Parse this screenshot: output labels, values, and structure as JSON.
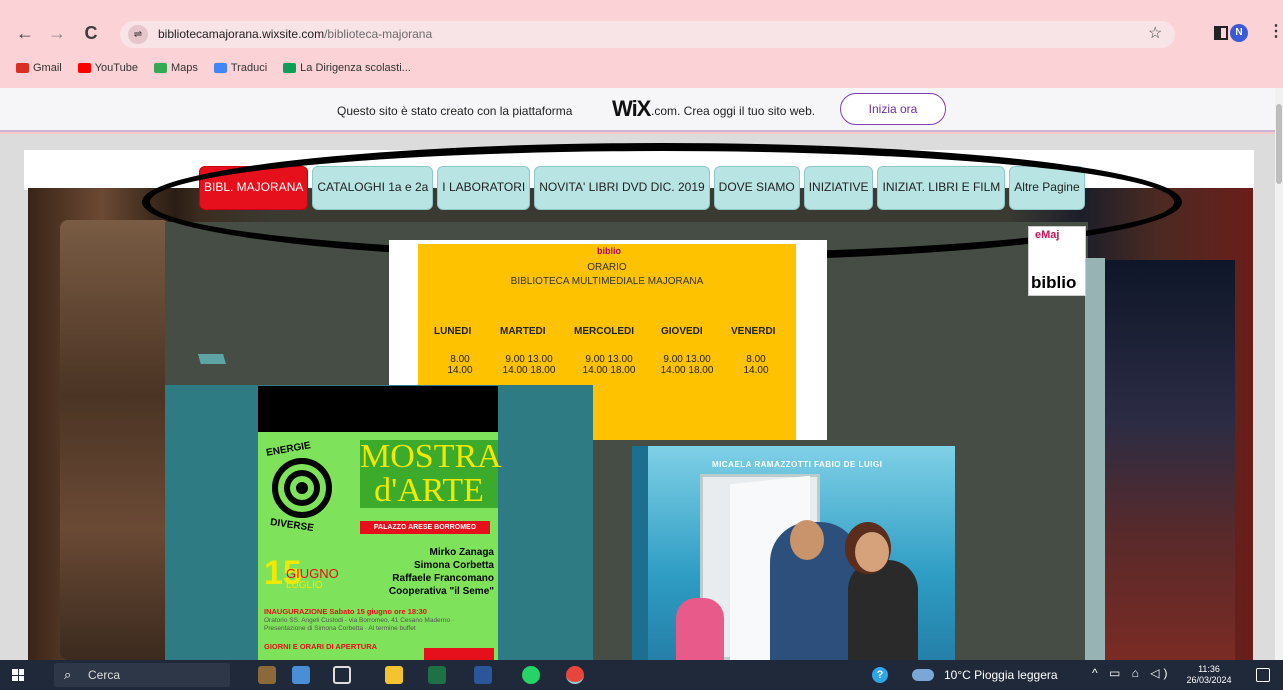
{
  "browser": {
    "nav": {
      "back": "←",
      "forward": "→",
      "reload": "C"
    },
    "url_host": "bibliotecamajorana.wixsite.com",
    "url_path": "/biblioteca-majorana",
    "star": "☆",
    "profile_initial": "N",
    "menu": "⋮"
  },
  "bookmarks": [
    {
      "label": "Gmail",
      "color": "#d93025"
    },
    {
      "label": "YouTube",
      "color": "#ff0000"
    },
    {
      "label": "Maps",
      "color": "#34a853"
    },
    {
      "label": "Traduci",
      "color": "#4285f4"
    },
    {
      "label": "La Dirigenza scolasti...",
      "color": "#0f9d58"
    }
  ],
  "wix_banner": {
    "text": "Questo sito è stato creato con la piattaforma",
    "logo": "WiX",
    "suffix": ".com. Crea oggi il tuo sito web.",
    "button": "Inizia ora"
  },
  "site_menu": [
    {
      "label": "BIBL. MAJORANA",
      "active": true
    },
    {
      "label": "CATALOGHI 1a e 2a",
      "active": false
    },
    {
      "label": "I LABORATORI",
      "active": false
    },
    {
      "label": "NOVITA' LIBRI DVD DIC. 2019",
      "active": false
    },
    {
      "label": "DOVE SIAMO",
      "active": false
    },
    {
      "label": "INIZIATIVE",
      "active": false
    },
    {
      "label": "INIZIAT. LIBRI E FILM",
      "active": false
    },
    {
      "label": "Altre Pagine",
      "active": false
    }
  ],
  "biblio_logo": {
    "top": "eMaj",
    "word": "biblio"
  },
  "orario": {
    "logo": "biblio",
    "title": "ORARIO",
    "subtitle": "BIBLIOTECA MULTIMEDIALE MAJORANA",
    "days": [
      "LUNEDI",
      "MARTEDI",
      "MERCOLEDI",
      "GIOVEDI",
      "VENERDI"
    ],
    "hours": [
      "8.00\n14.00",
      "9.00 13.00\n14.00 18.00",
      "9.00 13.00\n14.00 18.00",
      "9.00 13.00\n14.00 18.00",
      "8.00\n14.00"
    ]
  },
  "poster": {
    "energie": "ENERGIE",
    "diverse": "DIVERSE",
    "title1": "MOSTRA",
    "title2": "d'ARTE",
    "palazzo": "PALAZZO ARESE BORROMEO",
    "names": [
      "Mirko Zanaga",
      "Simona Corbetta",
      "Raffaele Francomano",
      "Cooperativa \"il Seme\""
    ],
    "day": "15",
    "month": "GIUGNO",
    "month2": "LUGLIO",
    "inaug": "INAUGURAZIONE Sabato 15 giugno ore 18:30",
    "inaug_detail": "Oratorio SS. Angeli Custodi - via Borromeo, 41 Cesano Maderno · Presentazione di Simona Corbetta · Al termine buffet",
    "giorni": "GIORNI E ORARI DI APERTURA"
  },
  "movie": {
    "actors": "MICAELA RAMAZZOTTI    FABIO DE LUIGI"
  },
  "taskbar": {
    "search_placeholder": "Cerca",
    "weather": "10°C  Pioggia leggera",
    "time": "11:36",
    "date": "26/03/2024"
  }
}
